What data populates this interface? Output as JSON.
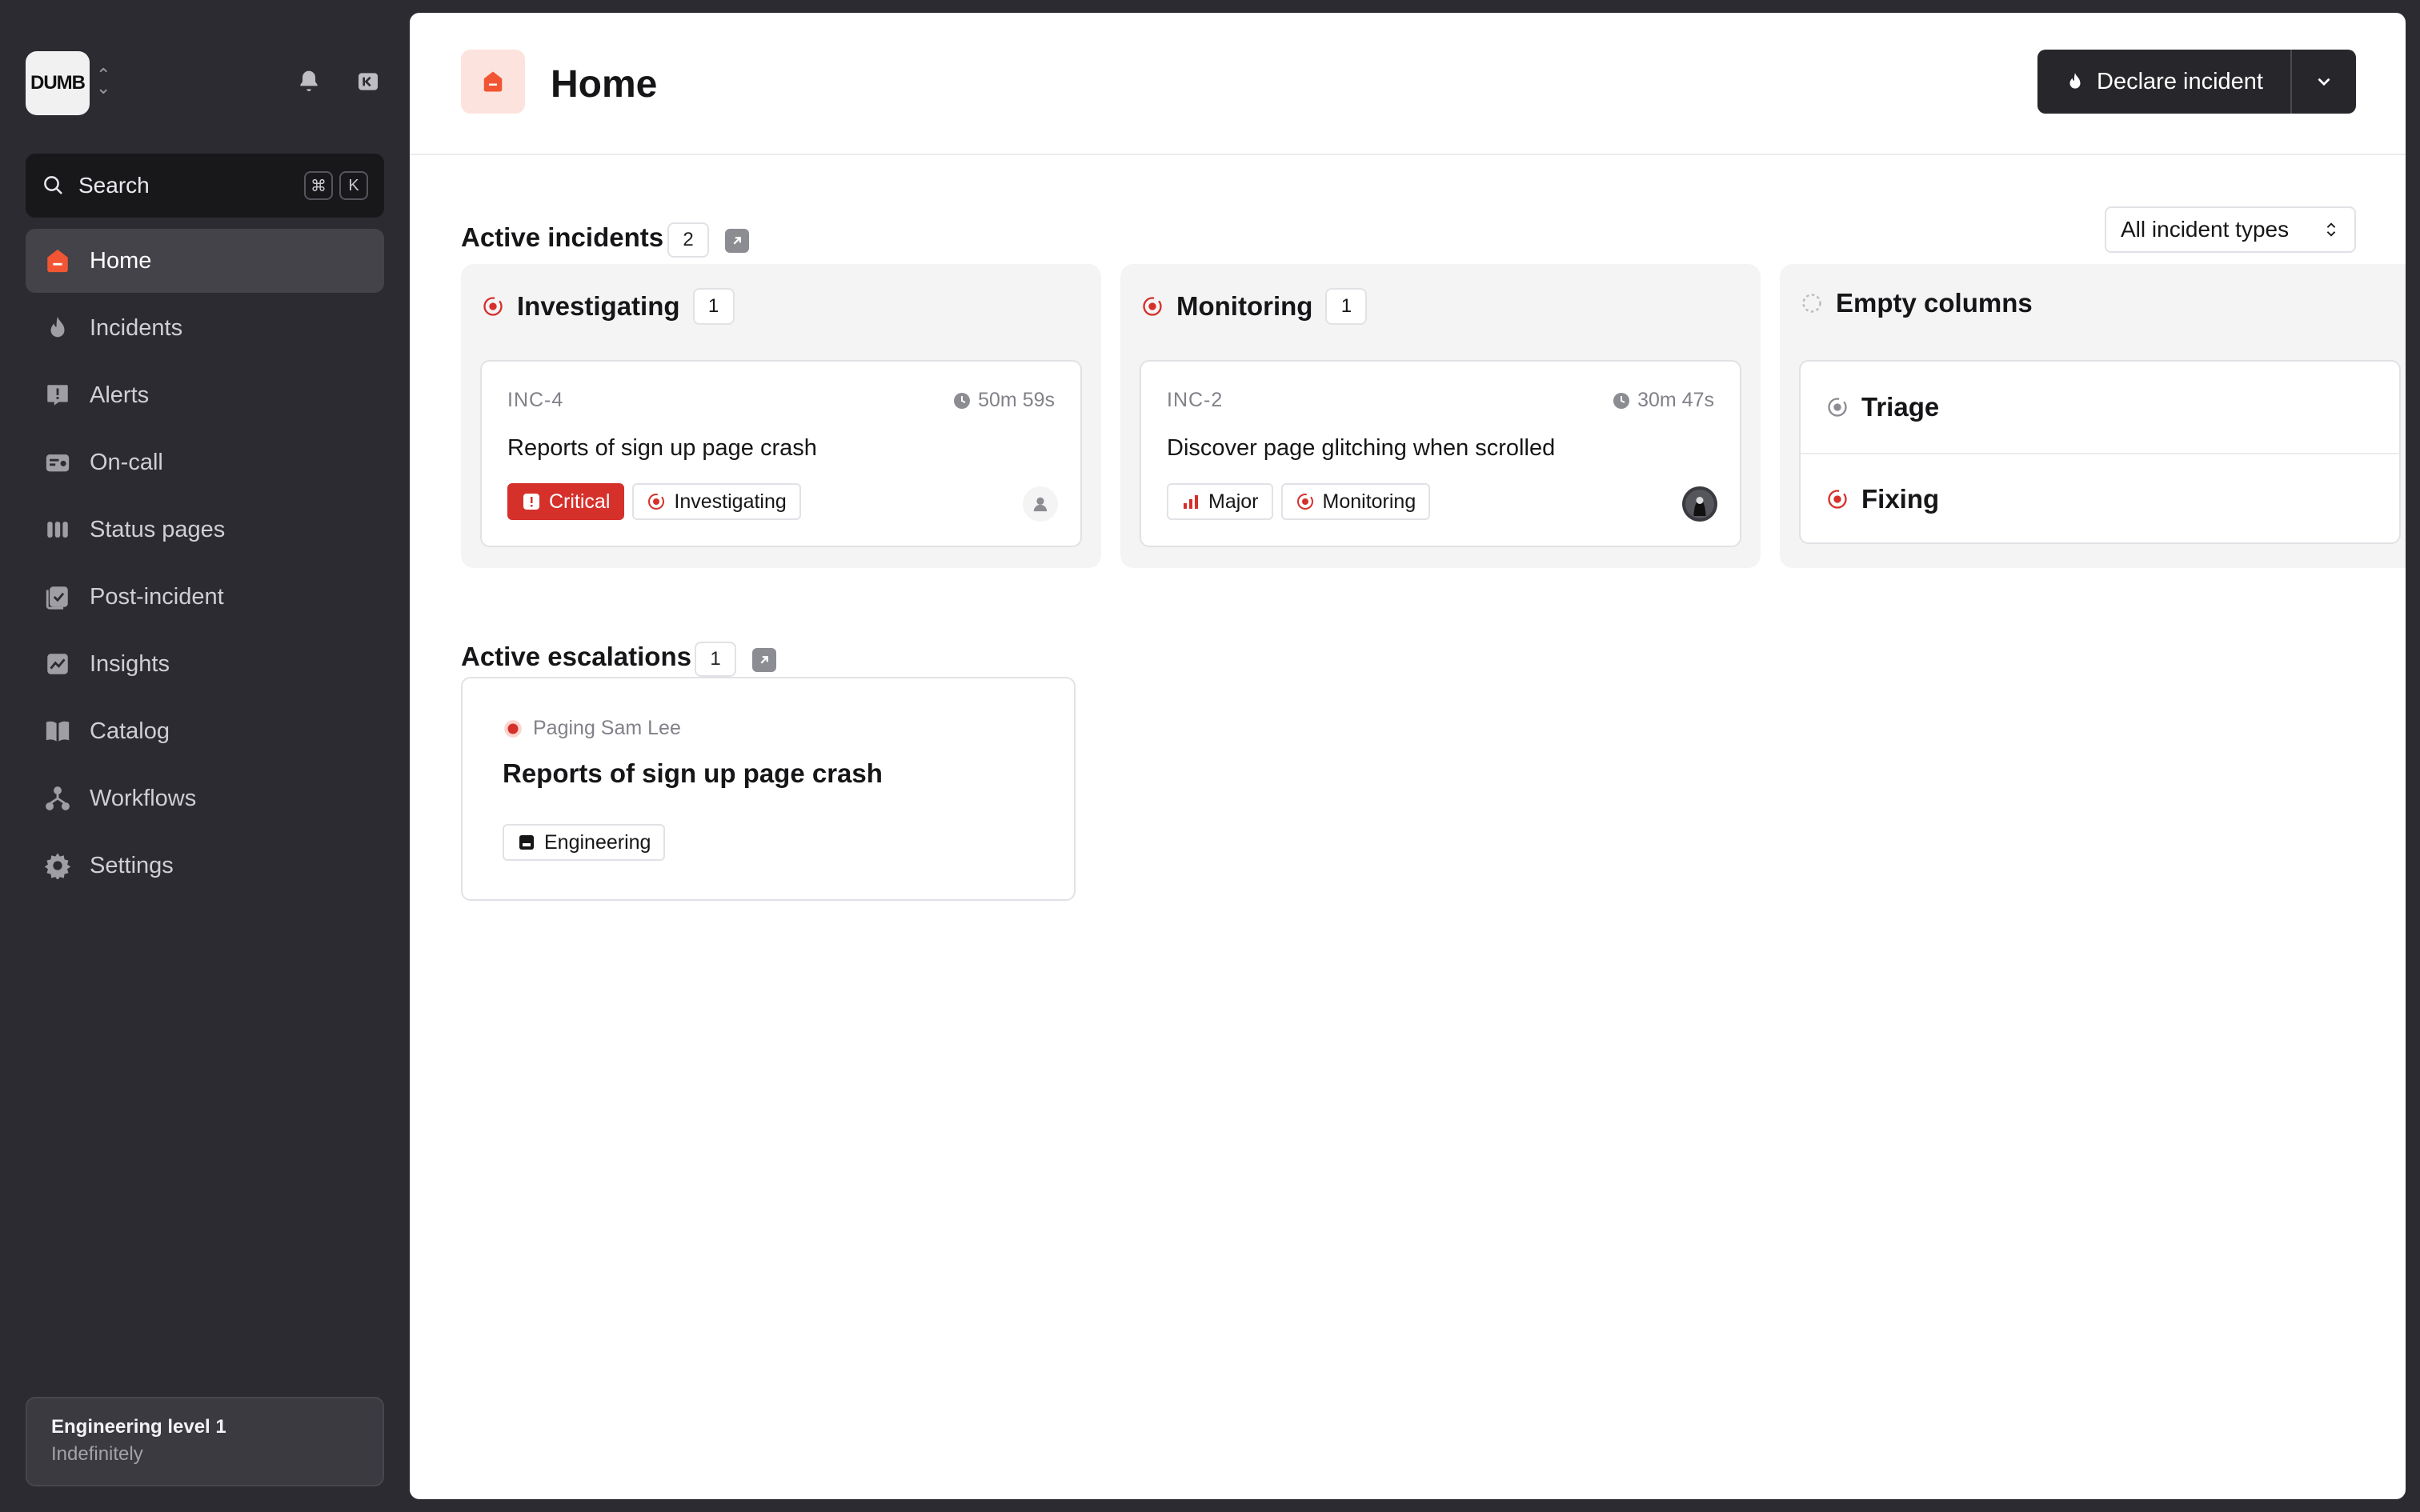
{
  "sidebar": {
    "logo_text": "DUMB",
    "search": {
      "label": "Search",
      "shortcut_cmd": "⌘",
      "shortcut_key": "K"
    },
    "items": [
      {
        "label": "Home",
        "icon": "home-icon"
      },
      {
        "label": "Incidents",
        "icon": "flame-icon"
      },
      {
        "label": "Alerts",
        "icon": "alert-icon"
      },
      {
        "label": "On-call",
        "icon": "oncall-icon"
      },
      {
        "label": "Status pages",
        "icon": "status-bars-icon"
      },
      {
        "label": "Post-incident",
        "icon": "check-doc-icon"
      },
      {
        "label": "Insights",
        "icon": "chart-icon"
      },
      {
        "label": "Catalog",
        "icon": "book-icon"
      },
      {
        "label": "Workflows",
        "icon": "workflow-icon"
      },
      {
        "label": "Settings",
        "icon": "gear-icon"
      }
    ],
    "oncall": {
      "title": "Engineering level 1",
      "subtitle": "Indefinitely"
    }
  },
  "header": {
    "title": "Home",
    "declare_label": "Declare incident"
  },
  "active_incidents": {
    "title": "Active incidents",
    "count": "2",
    "filter_label": "All incident types",
    "columns": [
      {
        "name": "Investigating",
        "count": "1",
        "card": {
          "ref": "INC-4",
          "duration": "50m 59s",
          "name": "Reports of sign up page crash",
          "severity": "Critical",
          "status": "Investigating"
        }
      },
      {
        "name": "Monitoring",
        "count": "1",
        "card": {
          "ref": "INC-2",
          "duration": "30m 47s",
          "name": "Discover page glitching when scrolled",
          "severity": "Major",
          "status": "Monitoring"
        }
      }
    ],
    "empty_columns": {
      "title": "Empty columns",
      "items": [
        "Triage",
        "Fixing"
      ]
    }
  },
  "active_escalations": {
    "title": "Active escalations",
    "count": "1",
    "card": {
      "paging": "Paging Sam Lee",
      "title": "Reports of sign up page crash",
      "team": "Engineering"
    }
  },
  "colors": {
    "sidebar_bg": "#2b2b31",
    "accent": "#f25533",
    "critical": "#d6302b",
    "primary_button": "#27272b"
  }
}
